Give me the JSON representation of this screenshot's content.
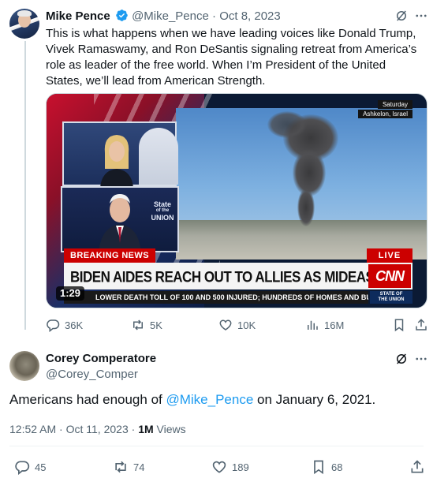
{
  "tweet": {
    "author_name": "Mike Pence",
    "handle": "@Mike_Pence",
    "separator": "·",
    "date": "Oct 8, 2023",
    "text": "This is what happens when we have leading voices like Donald Trump, Vivek Ramaswamy, and Ron DeSantis signaling retreat from America’s role as leader of the free world. When I’m President of the United States, we’ll lead from American Strength.",
    "media": {
      "tag_day": "Saturday",
      "tag_location": "Ashkelon, Israel",
      "breaking": "BREAKING NEWS",
      "live": "LIVE",
      "headline": "BIDEN AIDES REACH OUT TO ALLIES AS MIDEAST CRISIS GROWS",
      "network_logo": "CNN",
      "ticker": "LOWER DEATH TOLL OF 100 AND 500 INJURED; HUNDREDS OF HOMES AND BUILDIN",
      "show_bug_line1": "STATE OF",
      "show_bug_line2": "THE UNION",
      "inset_show_1": "State",
      "inset_show_2": "of the",
      "inset_show_3": "UNION",
      "duration": "1:29"
    },
    "stats": {
      "replies": "36K",
      "reposts": "5K",
      "likes": "10K",
      "views": "16M"
    }
  },
  "reply": {
    "author_name": "Corey Comperatore",
    "handle": "@Corey_Comper",
    "text_before": "Americans had enough of ",
    "mention": "@Mike_Pence",
    "text_after": " on January 6, 2021.",
    "time": "12:52 AM",
    "separator": "·",
    "date": "Oct 11, 2023",
    "separator2": "·",
    "views_count": "1M",
    "views_label": "Views",
    "stats": {
      "replies": "45",
      "reposts": "74",
      "likes": "189",
      "bookmarks": "68"
    }
  },
  "colors": {
    "text": "#0f1419",
    "muted": "#536471",
    "link": "#1d9bf0",
    "verified": "#1d9bf0",
    "thread_line": "#cfd9de",
    "breaking_red": "#cc0000"
  },
  "icons": [
    "verified-badge-icon",
    "grok-icon",
    "more-icon",
    "reply-icon",
    "repost-icon",
    "like-icon",
    "views-icon",
    "bookmark-icon",
    "share-icon"
  ]
}
